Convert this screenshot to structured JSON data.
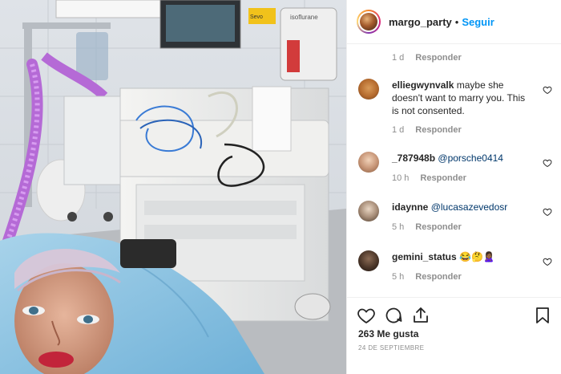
{
  "post": {
    "username": "margo_party",
    "dot": "•",
    "follow_label": "Seguir",
    "photo_labels": {
      "vaporizer_brand": "isoflurane",
      "yellow_tag": "Sevo"
    }
  },
  "comments": [
    {
      "id": "prev",
      "username": "",
      "text": "",
      "time": "1 d",
      "reply_label": "Responder"
    },
    {
      "id": "c1",
      "username": "elliegwynvalk",
      "text": "maybe she doesn't want to marry you. This is not consented.",
      "mention": "",
      "emoji": "",
      "time": "1 d",
      "reply_label": "Responder"
    },
    {
      "id": "c2",
      "username": "_787948b",
      "text": "",
      "mention": "@porsche0414",
      "emoji": "",
      "time": "10 h",
      "reply_label": "Responder"
    },
    {
      "id": "c3",
      "username": "idaynne",
      "text": "",
      "mention": "@lucasazevedosr",
      "emoji": "",
      "time": "5 h",
      "reply_label": "Responder"
    },
    {
      "id": "c4",
      "username": "gemini_status",
      "text": "",
      "mention": "",
      "emoji": "😂🤔🙎🏾‍♀️",
      "time": "5 h",
      "reply_label": "Responder"
    }
  ],
  "actions": {
    "likes": "263 Me gusta",
    "date": "24 DE SEPTIEMBRE",
    "icons": [
      "heart-icon",
      "comment-icon",
      "share-icon",
      "bookmark-icon"
    ]
  },
  "colors": {
    "link": "#0095f6",
    "mention": "#00376b",
    "muted": "#8e8e8e",
    "text": "#262626"
  }
}
